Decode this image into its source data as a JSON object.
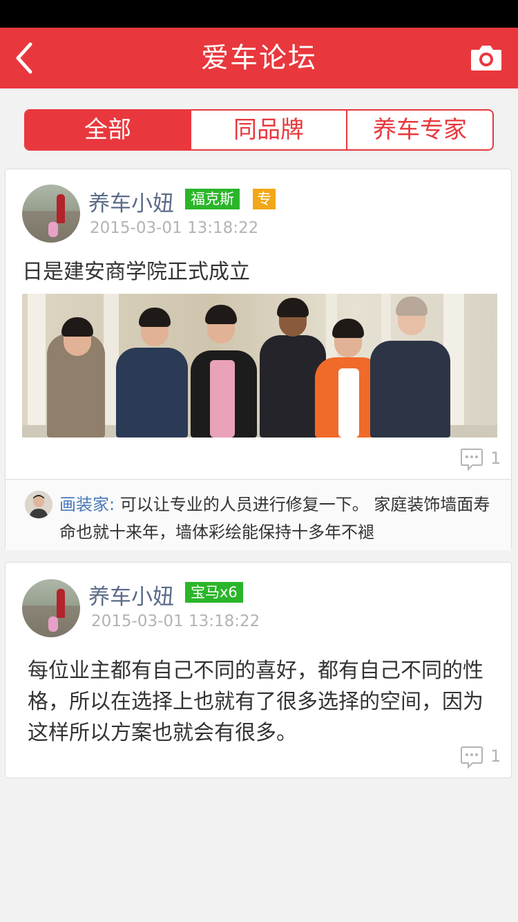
{
  "header": {
    "title": "爱车论坛",
    "back_icon": "chevron-left-icon",
    "camera_icon": "camera-icon"
  },
  "tabs": [
    {
      "label": "全部",
      "active": true
    },
    {
      "label": "同品牌",
      "active": false
    },
    {
      "label": "养车专家",
      "active": false
    }
  ],
  "posts": [
    {
      "username": "养车小妞",
      "tags": [
        {
          "label": "福克斯",
          "color": "#2bb52a"
        },
        {
          "label": "专",
          "color": "#f1a818"
        }
      ],
      "time": "2015-03-01 13:18:22",
      "text": "日是建安商学院正式成立",
      "has_photo": true,
      "comment_count": "1",
      "reply": {
        "name": "画装家:",
        "text": "可以让专业的人员进行修复一下。 家庭装饰墙面寿命也就十来年，墙体彩绘能保持十多年不褪"
      }
    },
    {
      "username": "养车小妞",
      "tags": [
        {
          "label": "宝马x6",
          "color": "#2bb52a"
        }
      ],
      "time": "2015-03-01 13:18:22",
      "text": "每位业主都有自己不同的喜好，都有自己不同的性格，所以在选择上也就有了很多选择的空间，因为这样所以方案也就会有很多。",
      "has_photo": false,
      "comment_count": "1"
    }
  ],
  "colors": {
    "brand": "#e8383d",
    "tag_green": "#2bb52a",
    "tag_orange": "#f1a818",
    "username": "#5b6b88",
    "reply_name": "#4a7ab8"
  }
}
